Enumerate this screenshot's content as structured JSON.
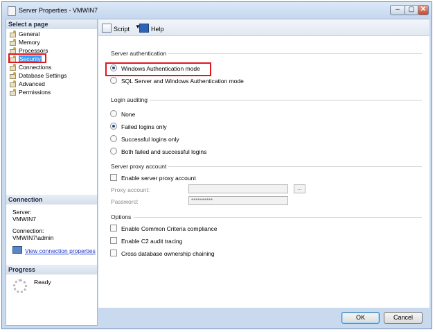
{
  "window": {
    "title": "Server Properties - VMWIN7",
    "controls": {
      "minimize": "–",
      "maximize": "▢",
      "close": "✕"
    }
  },
  "left": {
    "select_a_page_header": "Select a page",
    "pages": [
      {
        "label": "General",
        "selected": false
      },
      {
        "label": "Memory",
        "selected": false
      },
      {
        "label": "Processors",
        "selected": false
      },
      {
        "label": "Security",
        "selected": true
      },
      {
        "label": "Connections",
        "selected": false
      },
      {
        "label": "Database Settings",
        "selected": false
      },
      {
        "label": "Advanced",
        "selected": false
      },
      {
        "label": "Permissions",
        "selected": false
      }
    ],
    "connection_header": "Connection",
    "server_label": "Server:",
    "server_value": "VMWIN7",
    "connection_label": "Connection:",
    "connection_value": "VMWIN7\\admin",
    "view_connection_properties": "View connection properties",
    "progress_header": "Progress",
    "progress_status": "Ready"
  },
  "toolbar": {
    "script_label": "Script",
    "help_label": "Help",
    "dropdown_arrow": "▼"
  },
  "server_authentication": {
    "title": "Server authentication",
    "options": [
      {
        "label": "Windows Authentication mode",
        "checked": true
      },
      {
        "label": "SQL Server and Windows Authentication mode",
        "checked": false
      }
    ]
  },
  "login_auditing": {
    "title": "Login auditing",
    "options": [
      {
        "label": "None",
        "checked": false
      },
      {
        "label": "Failed logins only",
        "checked": true
      },
      {
        "label": "Successful logins only",
        "checked": false
      },
      {
        "label": "Both failed and successful logins",
        "checked": false
      }
    ]
  },
  "proxy": {
    "title": "Server proxy account",
    "enable_label": "Enable server proxy account",
    "enable_checked": false,
    "account_label": "Proxy account:",
    "account_value": "",
    "password_label": "Password:",
    "password_value": "**********",
    "browse_label": "..."
  },
  "options": {
    "title": "Options",
    "items": [
      {
        "label": "Enable Common Criteria compliance",
        "checked": false
      },
      {
        "label": "Enable C2 audit tracing",
        "checked": false
      },
      {
        "label": "Cross database ownership chaining",
        "checked": false
      }
    ]
  },
  "buttons": {
    "ok": "OK",
    "cancel": "Cancel"
  },
  "colors": {
    "highlight_box": "#e0161d",
    "selection": "#3399ff",
    "link": "#1a38c8"
  }
}
